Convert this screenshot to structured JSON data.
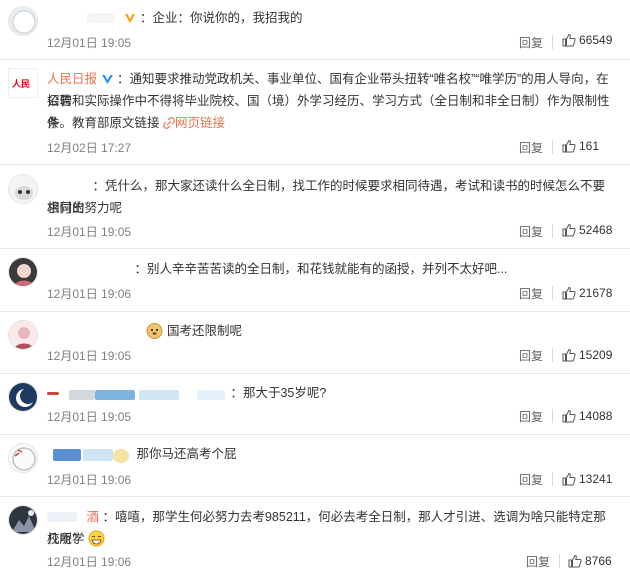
{
  "comments": [
    {
      "username": "",
      "text": "：企业：你说你的，我招我的",
      "date": "12月01日 19:05",
      "reply": "回复",
      "likes": "66549"
    },
    {
      "username": "人民日报",
      "text_line1": "：通知要求推动党政机关、事业单位、国有企业带头扭转“唯名校”“唯学历”的用人导向，在招聘",
      "text_line2": "公告和实际操作中不得将毕业院校、国（境）外学习经历、学习方式（全日制和非全日制）作为限制性条",
      "text_line3_prefix": "件。教育部原文链接",
      "link_text": "网页链接",
      "date": "12月02日 17:27",
      "reply": "回复",
      "likes": "161"
    },
    {
      "username": "",
      "text_line1": "：凭什么，那大家还读什么全日制，找工作的时候要求相同待遇，考试和读书的时候怎么不要求付出",
      "text_line2": "相同的努力呢",
      "date": "12月01日 19:05",
      "reply": "回复",
      "likes": "52468"
    },
    {
      "username": "",
      "text": "：别人辛辛苦苦读的全日制，和花钱就能有的函授，并列不太好吧...",
      "date": "12月01日 19:06",
      "reply": "回复",
      "likes": "21678"
    },
    {
      "username": "",
      "text": "国考还限制呢",
      "date": "12月01日 19:05",
      "reply": "回复",
      "likes": "15209"
    },
    {
      "username": "",
      "text": "：那大于35岁呢?",
      "date": "12月01日 19:05",
      "reply": "回复",
      "likes": "14088"
    },
    {
      "username": "",
      "text": "那你马还高考个屁",
      "date": "12月01日 19:06",
      "reply": "回复",
      "likes": "13241"
    },
    {
      "username": "酒",
      "text_line1": "：嘻嘻，那学生何必努力去考985211，何必去考全日制，那人才引进、选调为啥只能特定那几所学",
      "text_line2": "校呢？",
      "date": "12月01日 19:06",
      "reply": "回复",
      "likes": "8766"
    }
  ],
  "colors": {
    "accent": "#eb7350",
    "vip": "#ffa000",
    "verified": "#2a8fe6",
    "meta": "#808080"
  },
  "icons": [
    "thumb-up-icon",
    "verified-v-icon",
    "link-icon",
    "doge-emoji-icon",
    "grin-emoji-icon"
  ]
}
